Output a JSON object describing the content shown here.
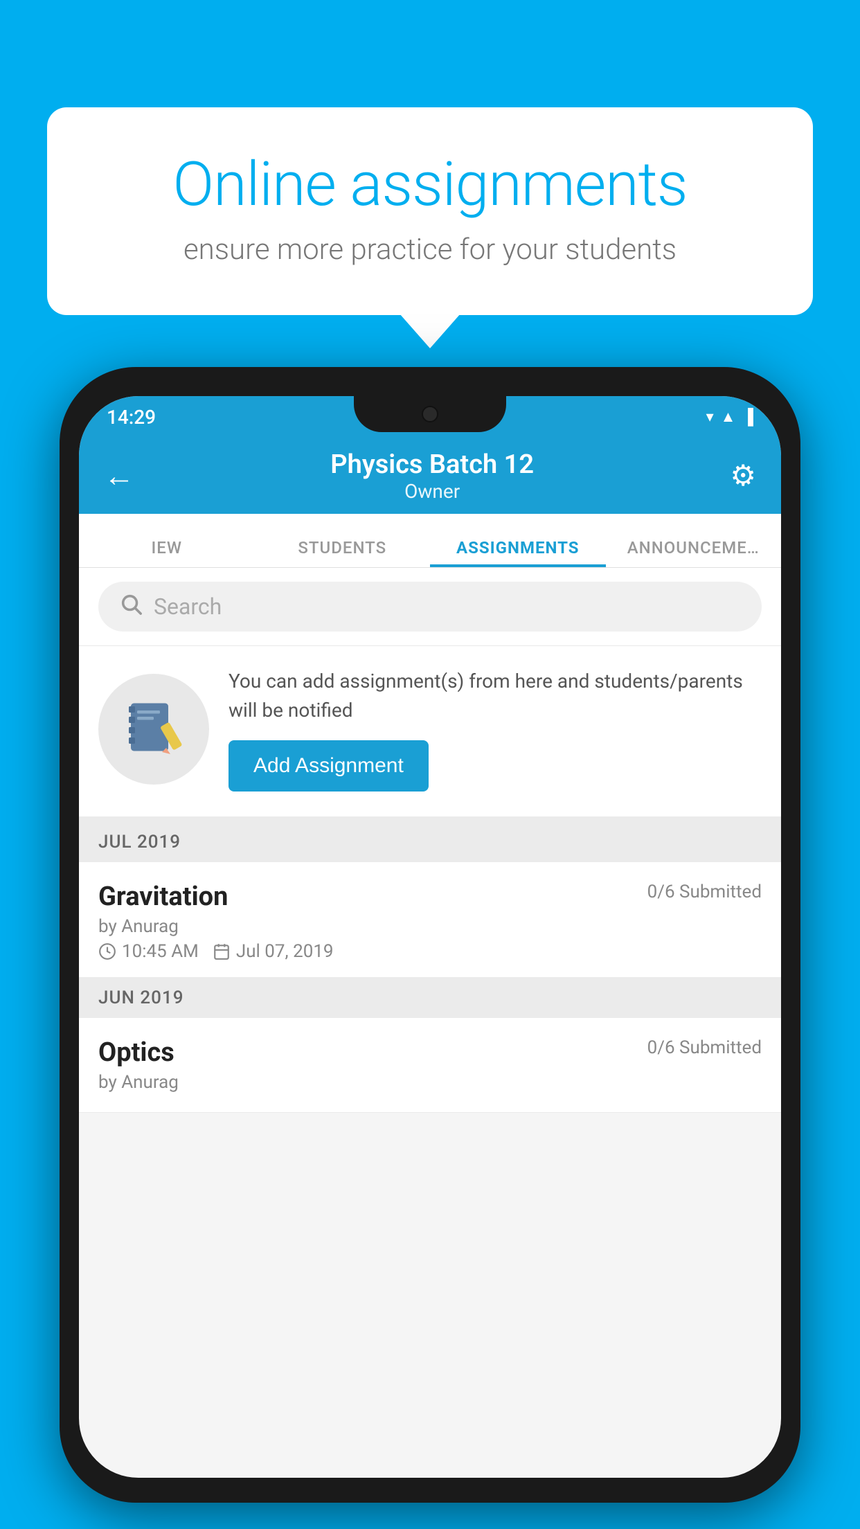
{
  "background_color": "#00AEEF",
  "speech_bubble": {
    "title": "Online assignments",
    "subtitle": "ensure more practice for your students"
  },
  "status_bar": {
    "time": "14:29",
    "icons": "▼◄▐"
  },
  "app_header": {
    "title": "Physics Batch 12",
    "subtitle": "Owner",
    "back_label": "←",
    "settings_label": "⚙"
  },
  "tabs": [
    {
      "label": "IEW",
      "active": false
    },
    {
      "label": "STUDENTS",
      "active": false
    },
    {
      "label": "ASSIGNMENTS",
      "active": true
    },
    {
      "label": "ANNOUNCEMENTS",
      "active": false
    }
  ],
  "search": {
    "placeholder": "Search"
  },
  "promo": {
    "description": "You can add assignment(s) from here and students/parents will be notified",
    "button_label": "Add Assignment"
  },
  "sections": [
    {
      "header": "JUL 2019",
      "assignments": [
        {
          "name": "Gravitation",
          "submitted": "0/6 Submitted",
          "author": "by Anurag",
          "time": "10:45 AM",
          "date": "Jul 07, 2019"
        }
      ]
    },
    {
      "header": "JUN 2019",
      "assignments": [
        {
          "name": "Optics",
          "submitted": "0/6 Submitted",
          "author": "by Anurag",
          "time": "",
          "date": ""
        }
      ]
    }
  ]
}
